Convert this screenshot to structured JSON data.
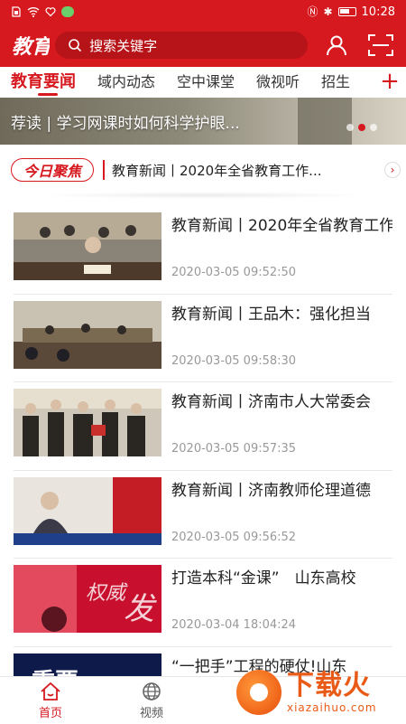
{
  "status_bar": {
    "time": "10:28",
    "left_icons": [
      "sim-icon",
      "wifi-icon",
      "heart-icon",
      "wechat-icon"
    ],
    "right_icons": [
      "nfc-icon",
      "bluetooth-icon",
      "battery-icon"
    ]
  },
  "header": {
    "logo_text": "济南教育",
    "search_placeholder": "搜索关键字",
    "accent": "#d6191f"
  },
  "tabs": {
    "items": [
      "教育要闻",
      "域内动态",
      "空中课堂",
      "微视听",
      "招生"
    ],
    "active_index": 0,
    "add_label": "+"
  },
  "banner": {
    "caption": "荐读 | 学习网课时如何科学护眼...",
    "slide_count": 3,
    "active_slide": 1
  },
  "focus": {
    "tag": "今日聚焦",
    "headline": "教育新闻丨2020年全省教育工作...",
    "arrow": "›"
  },
  "news": [
    {
      "title": "教育新闻丨2020年全省教育工作",
      "time": "2020-03-05 09:52:50",
      "thumb": "meeting-photo"
    },
    {
      "title": "教育新闻丨王品木：强化担当",
      "time": "2020-03-05 09:58:30",
      "thumb": "conference-room-photo"
    },
    {
      "title": "教育新闻丨济南市人大常委会",
      "time": "2020-03-05 09:57:35",
      "thumb": "award-ceremony-photo"
    },
    {
      "title": "教育新闻丨济南教师伦理道德",
      "time": "2020-03-05 09:56:52",
      "thumb": "calligraphy-video-still"
    },
    {
      "title": "打造本科“金课”　山东高校",
      "time": "2020-03-04 18:04:24",
      "thumb": "authority-release-graphic"
    },
    {
      "title": "“一把手”工程的硬仗!山东",
      "time": "",
      "thumb": "important-graphic"
    }
  ],
  "tabbar": {
    "items": [
      {
        "label": "首页",
        "icon": "home-icon",
        "active": true
      },
      {
        "label": "视频",
        "icon": "globe-icon",
        "active": false
      }
    ]
  },
  "watermark": {
    "cn": "下载火",
    "en": "xiazaihuo.com"
  }
}
